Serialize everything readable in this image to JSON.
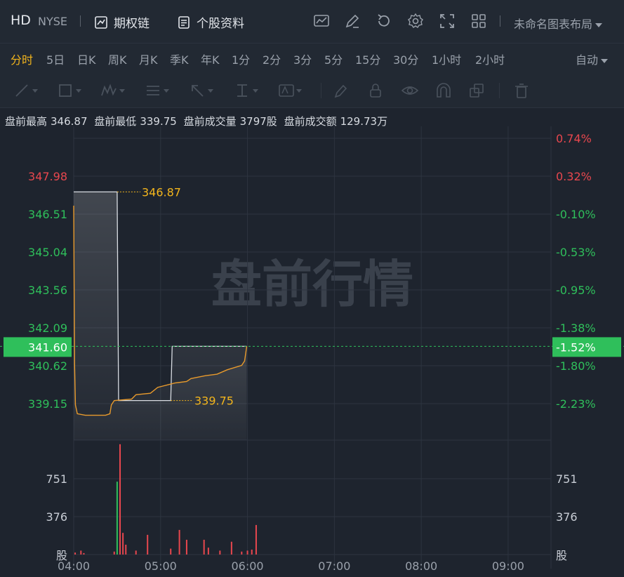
{
  "header": {
    "symbol": "HD",
    "exchange": "NYSE",
    "options_chain_label": "期权链",
    "stock_profile_label": "个股资料",
    "layout_name": "未命名图表布局"
  },
  "periods": {
    "items": [
      "分时",
      "5日",
      "日K",
      "周K",
      "月K",
      "季K",
      "年K",
      "1分",
      "2分",
      "3分",
      "5分",
      "15分",
      "30分",
      "1小时",
      "2小时"
    ],
    "active": "分时",
    "auto_label": "自动"
  },
  "stats": {
    "high_label": "盘前最高",
    "high_value": "346.87",
    "low_label": "盘前最低",
    "low_value": "339.75",
    "volume_label": "盘前成交量",
    "volume_value": "3797股",
    "amount_label": "盘前成交额",
    "amount_value": "129.73万"
  },
  "colors": {
    "up": "#e8474e",
    "down": "#2fbf5b",
    "line": "#e89a2c",
    "high_low_label": "#f3b51c",
    "current_badge": "#2fbf5b",
    "watermark": "#3a414c"
  },
  "chart_data": {
    "type": "line",
    "watermark": "盘前行情",
    "x_ticks": [
      "04:00",
      "05:00",
      "06:00",
      "07:00",
      "08:00",
      "09:00"
    ],
    "price_ticks": [
      "347.98",
      "346.51",
      "345.04",
      "343.56",
      "342.09",
      "340.62",
      "339.15"
    ],
    "pct_ticks": [
      "0.74%",
      "0.32%",
      "-0.10%",
      "-0.53%",
      "-0.95%",
      "-1.38%",
      "-1.80%",
      "-2.23%"
    ],
    "price_range": [
      338.4,
      348.7
    ],
    "current_price": "341.60",
    "current_pct": "-1.52%",
    "high_label": "346.87",
    "low_label": "339.75",
    "volume_ticks_left": [
      "751",
      "376"
    ],
    "volume_ticks_right": [
      "751",
      "376"
    ],
    "volume_unit": "股",
    "session_start_min": 240,
    "session_end_min": 600,
    "price_series": [
      {
        "t": 240.0,
        "p": 346.4
      },
      {
        "t": 240.6,
        "p": 341.0
      },
      {
        "t": 241.2,
        "p": 339.6
      },
      {
        "t": 242.5,
        "p": 339.3
      },
      {
        "t": 248,
        "p": 339.25
      },
      {
        "t": 262,
        "p": 339.25
      },
      {
        "t": 265,
        "p": 339.3
      },
      {
        "t": 266,
        "p": 339.6
      },
      {
        "t": 268,
        "p": 339.75
      },
      {
        "t": 280,
        "p": 339.8
      },
      {
        "t": 283,
        "p": 339.95
      },
      {
        "t": 293,
        "p": 340.0
      },
      {
        "t": 298,
        "p": 340.2
      },
      {
        "t": 310,
        "p": 340.35
      },
      {
        "t": 318,
        "p": 340.4
      },
      {
        "t": 321,
        "p": 340.5
      },
      {
        "t": 331,
        "p": 340.6
      },
      {
        "t": 339,
        "p": 340.65
      },
      {
        "t": 346,
        "p": 340.8
      },
      {
        "t": 356,
        "p": 340.95
      },
      {
        "t": 358,
        "p": 341.1
      },
      {
        "t": 359.5,
        "p": 341.6
      }
    ],
    "high_low_overlay": [
      {
        "t": 240,
        "p": 346.87
      },
      {
        "t": 270,
        "p": 346.87
      },
      {
        "t": 271,
        "p": 339.75
      },
      {
        "t": 307,
        "p": 339.75
      },
      {
        "t": 308,
        "p": 341.6
      },
      {
        "t": 359.5,
        "p": 341.6
      }
    ],
    "volume_max": 1126,
    "volume_bars": [
      {
        "t": 241,
        "v": 20,
        "dir": "up"
      },
      {
        "t": 245,
        "v": 40,
        "dir": "up"
      },
      {
        "t": 247,
        "v": 15,
        "dir": "up"
      },
      {
        "t": 268,
        "v": 30,
        "dir": "up"
      },
      {
        "t": 270,
        "v": 740,
        "dir": "down"
      },
      {
        "t": 272,
        "v": 1120,
        "dir": "up"
      },
      {
        "t": 274,
        "v": 220,
        "dir": "up"
      },
      {
        "t": 276,
        "v": 100,
        "dir": "up"
      },
      {
        "t": 283,
        "v": 40,
        "dir": "up"
      },
      {
        "t": 291,
        "v": 200,
        "dir": "up"
      },
      {
        "t": 307,
        "v": 60,
        "dir": "up"
      },
      {
        "t": 313,
        "v": 250,
        "dir": "up"
      },
      {
        "t": 318,
        "v": 150,
        "dir": "up"
      },
      {
        "t": 330,
        "v": 150,
        "dir": "up"
      },
      {
        "t": 333,
        "v": 70,
        "dir": "up"
      },
      {
        "t": 341,
        "v": 40,
        "dir": "up"
      },
      {
        "t": 349,
        "v": 130,
        "dir": "up"
      },
      {
        "t": 356,
        "v": 30,
        "dir": "up"
      },
      {
        "t": 360,
        "v": 40,
        "dir": "up"
      },
      {
        "t": 363,
        "v": 50,
        "dir": "up"
      },
      {
        "t": 366,
        "v": 300,
        "dir": "up"
      }
    ]
  }
}
